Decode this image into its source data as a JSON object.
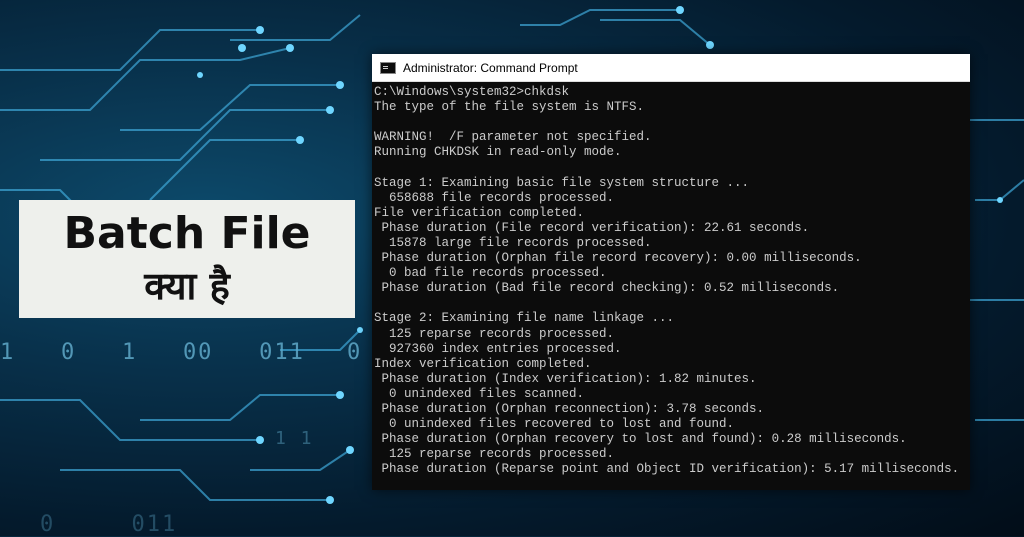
{
  "background": {
    "binary_rows": [
      "1   0   1   00   011",
      "0",
      "1 1",
      "0     011"
    ]
  },
  "title_card": {
    "line1": "Batch File",
    "line2": "क्या है"
  },
  "window": {
    "title": "Administrator: Command Prompt",
    "icon": "cmd-icon",
    "lines": [
      "C:\\Windows\\system32>chkdsk",
      "The type of the file system is NTFS.",
      "",
      "WARNING!  /F parameter not specified.",
      "Running CHKDSK in read-only mode.",
      "",
      "Stage 1: Examining basic file system structure ...",
      "  658688 file records processed.",
      "File verification completed.",
      " Phase duration (File record verification): 22.61 seconds.",
      "  15878 large file records processed.",
      " Phase duration (Orphan file record recovery): 0.00 milliseconds.",
      "  0 bad file records processed.",
      " Phase duration (Bad file record checking): 0.52 milliseconds.",
      "",
      "Stage 2: Examining file name linkage ...",
      "  125 reparse records processed.",
      "  927360 index entries processed.",
      "Index verification completed.",
      " Phase duration (Index verification): 1.82 minutes.",
      "  0 unindexed files scanned.",
      " Phase duration (Orphan reconnection): 3.78 seconds.",
      "  0 unindexed files recovered to lost and found.",
      " Phase duration (Orphan recovery to lost and found): 0.28 milliseconds.",
      "  125 reparse records processed.",
      " Phase duration (Reparse point and Object ID verification): 5.17 milliseconds."
    ]
  }
}
